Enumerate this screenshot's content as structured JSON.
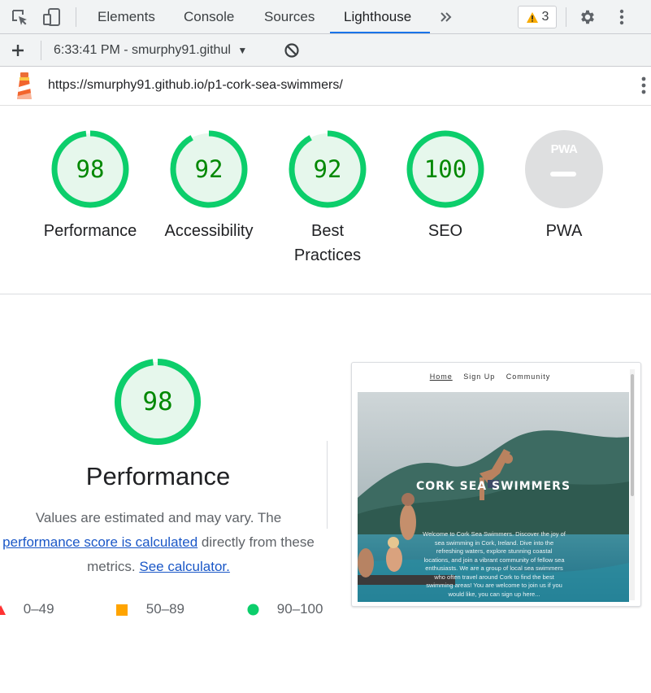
{
  "devtools": {
    "tabs": [
      {
        "label": "Elements"
      },
      {
        "label": "Console"
      },
      {
        "label": "Sources"
      },
      {
        "label": "Lighthouse"
      }
    ],
    "more_tabs_icon": "double-chevron-right",
    "warning_count": "3",
    "warning_color": "#f9ab00",
    "active_tab_color": "#1a73e8"
  },
  "toolbar": {
    "report_selector": "6:33:41 PM - smurphy91.githul"
  },
  "urlbar": {
    "url": "https://smurphy91.github.io/p1-cork-sea-swimmers/"
  },
  "scores": [
    {
      "value": "98",
      "label": "Performance",
      "fraction": 0.98
    },
    {
      "value": "92",
      "label": "Accessibility",
      "fraction": 0.92
    },
    {
      "value": "92",
      "label": "Best Practices",
      "fraction": 0.92
    },
    {
      "value": "100",
      "label": "SEO",
      "fraction": 1.0
    },
    {
      "value": "",
      "label": "PWA",
      "badge": "PWA"
    }
  ],
  "colors": {
    "pass": "#0cce6b",
    "pass_text": "#008800",
    "pass_fill": "#e6f7ec",
    "average": "#ffa400",
    "fail": "#ff3333",
    "pwa_gray": "#dedfe0"
  },
  "performance": {
    "score": "98",
    "fraction": 0.98,
    "title": "Performance",
    "desc_prefix": "Values are estimated and may vary. The",
    "desc_link": "performance score is calculated",
    "desc_middle": "directly from these metrics.",
    "calculator_link": "See calculator.",
    "legend": [
      {
        "range": "0–49",
        "shape": "triangle"
      },
      {
        "range": "50–89",
        "shape": "square"
      },
      {
        "range": "90–100",
        "shape": "circle"
      }
    ]
  },
  "preview": {
    "nav": [
      "Home",
      "Sign Up",
      "Community"
    ],
    "title": "CORK SEA SWIMMERS",
    "body": "Welcome to Cork Sea Swimmers. Discover the joy of sea swimming in Cork, Ireland. Dive into the refreshing waters, explore stunning coastal locations, and join a vibrant community of fellow sea enthusiasts. We are a group of local sea swimmers who often travel around Cork to find the best swimming areas! You are welcome to join us if you would like, you can sign up here..."
  }
}
